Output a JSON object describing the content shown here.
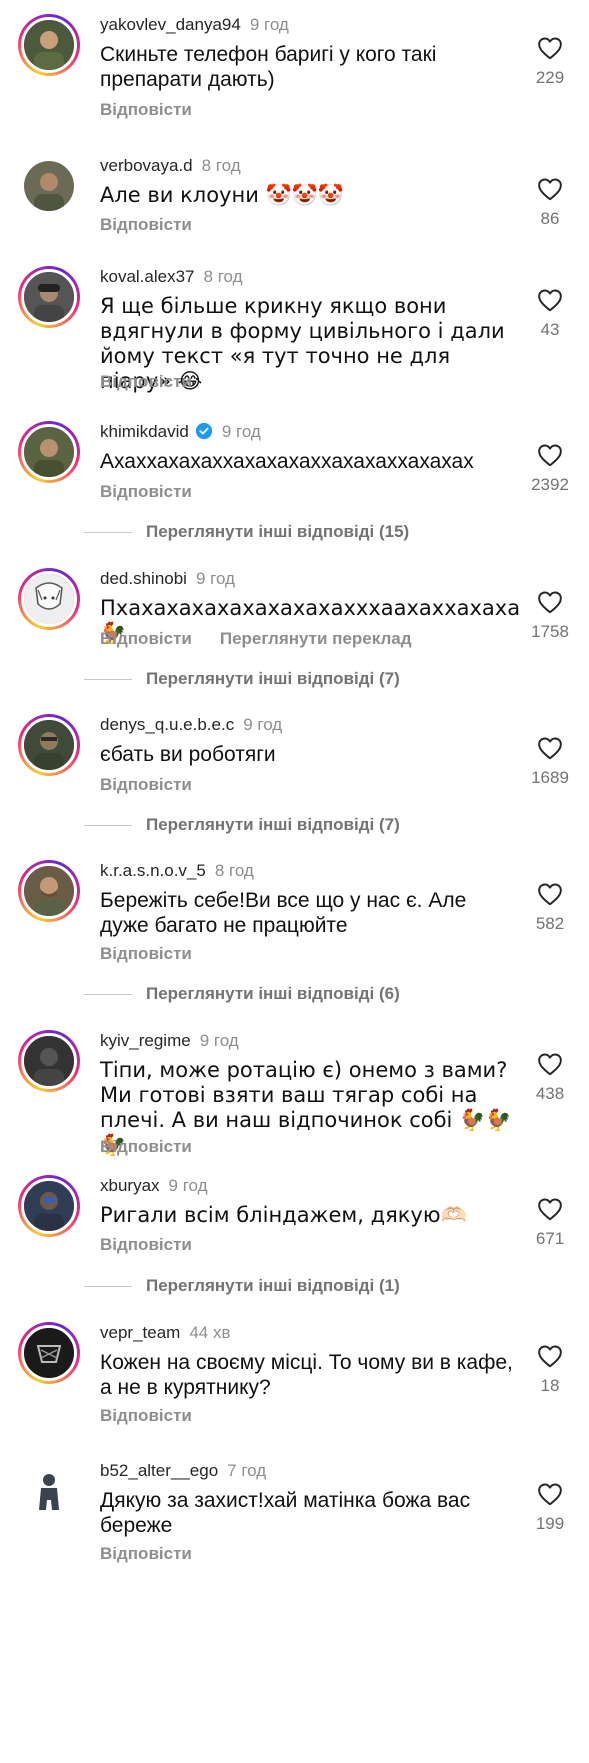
{
  "reply_label": "Відповісти",
  "translate_label": "Переглянути переклад",
  "comments": [
    {
      "username": "yakovlev_danya94",
      "time": "9 год",
      "text": "Скиньте телефон баригі у кого такі препарати дають)",
      "likes": "229",
      "avatar_color": "#4a5a3a"
    },
    {
      "username": "verbovaya.d",
      "time": "8 год",
      "text": "Але ви клоуни 🤡🤡🤡",
      "likes": "86",
      "avatar_color": "#6b6a55"
    },
    {
      "username": "koval.alex37",
      "time": "8 год",
      "text": "Я ще більше крикну якщо вони вдягнули в форму цивільного і дали йому текст «я тут точно не для піару» 😂",
      "likes": "43",
      "avatar_color": "#555555"
    },
    {
      "username": "khimikdavid",
      "time": "9 год",
      "text": "Ахаххахахаххахахахаххахахаххахахах",
      "likes": "2392",
      "avatar_color": "#5b6442",
      "verified": true
    },
    {
      "username": "ded.shinobi",
      "time": "9 год",
      "text": "Пхахахахахахахахахахххаахаххахаха 🐓",
      "likes": "1758",
      "avatar_color": "#dddddd"
    },
    {
      "username": "denys_q.u.e.b.e.c",
      "time": "9 год",
      "text": "єбать ви роботяги",
      "likes": "1689",
      "avatar_color": "#3f4a38"
    },
    {
      "username": "k.r.a.s.n.o.v_5",
      "time": "8 год",
      "text": "Бережіть себе!Ви все що у нас є. Але дуже багато не працюйте",
      "likes": "582",
      "avatar_color": "#6a5d45"
    },
    {
      "username": "kyiv_regime",
      "time": "9 год",
      "text": "Тіпи, може ротацію є) онемо з вами? Ми готові взяти ваш тягар собі на плечі. А ви наш відпочинок собі 🐓🐓🐓",
      "likes": "438",
      "avatar_color": "#333333"
    },
    {
      "username": "xburyax",
      "time": "9 год",
      "text": "Ригали всім бліндажем, дякую🫶🏻",
      "likes": "671",
      "avatar_color": "#2f3d55"
    },
    {
      "username": "vepr_team",
      "time": "44 хв",
      "text": "Кожен на своєму місці. То чому ви в кафе, а не в курятнику?",
      "likes": "18",
      "avatar_color": "#1a1a1a"
    },
    {
      "username": "b52_alter__ego",
      "time": "7 год",
      "text": "Дякую за захист!хай матінка божа вас береже",
      "likes": "199",
      "avatar_color": "#3b4350"
    }
  ],
  "more_replies": [
    "Переглянути інші відповіді (15)",
    "Переглянути інші відповіді (7)",
    "Переглянути інші відповіді (7)",
    "Переглянути інші відповіді (6)",
    "Переглянути інші відповіді (1)"
  ]
}
